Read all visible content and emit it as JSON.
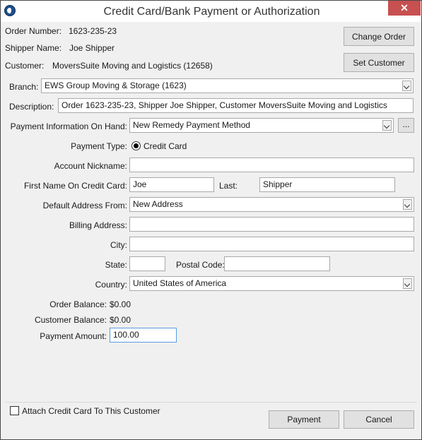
{
  "window": {
    "title": "Credit Card/Bank Payment or Authorization",
    "close_glyph": "✕"
  },
  "order": {
    "number_label": "Order Number:",
    "number": "1623-235-23",
    "shipper_label": "Shipper Name:",
    "shipper": "Joe Shipper",
    "customer_label": "Customer:",
    "customer": "MoversSuite Moving and Logistics (12658)"
  },
  "buttons": {
    "change_order": "Change Order",
    "set_customer": "Set Customer",
    "ellipsis": "...",
    "payment": "Payment",
    "cancel": "Cancel"
  },
  "branch": {
    "label": "Branch:",
    "value": "EWS Group Moving & Storage (1623)"
  },
  "description": {
    "label": "Description:",
    "value": "Order 1623-235-23, Shipper Joe Shipper, Customer MoversSuite Moving and Logistics"
  },
  "payment_info": {
    "label": "Payment Information On Hand:",
    "value": "New Remedy Payment Method"
  },
  "payment_type": {
    "label": "Payment Type:",
    "option": "Credit Card"
  },
  "account_nickname": {
    "label": "Account Nickname:",
    "value": ""
  },
  "card_name": {
    "first_label": "First Name On Credit Card:",
    "first": "Joe",
    "last_label": "Last:",
    "last": "Shipper"
  },
  "default_address": {
    "label": "Default Address From:",
    "value": "New Address"
  },
  "billing_address": {
    "label": "Billing Address:",
    "value": ""
  },
  "city": {
    "label": "City:",
    "value": ""
  },
  "state": {
    "label": "State:",
    "value": ""
  },
  "postal": {
    "label": "Postal Code:",
    "value": ""
  },
  "country": {
    "label": "Country:",
    "value": "United States of America"
  },
  "balances": {
    "order_label": "Order Balance:",
    "order": "$0.00",
    "customer_label": "Customer Balance:",
    "customer": "$0.00"
  },
  "payment_amount": {
    "label": "Payment Amount:",
    "value": "100.00"
  },
  "attach": {
    "label": "Attach Credit Card To This Customer",
    "checked": false
  }
}
